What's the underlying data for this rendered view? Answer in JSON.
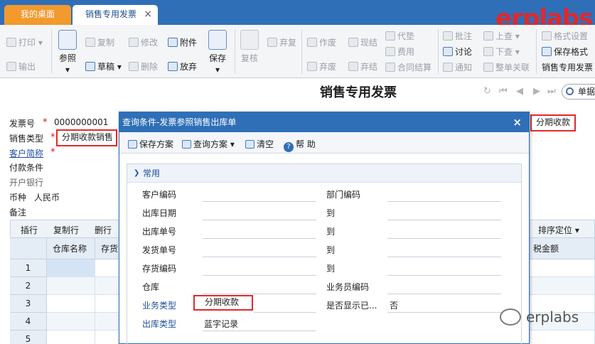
{
  "tabs": {
    "home": "我的桌面",
    "active": "销售专用发票",
    "close": "×"
  },
  "brand": "erplabs",
  "toolbar": {
    "print": "打印",
    "export": "输出",
    "reference": "参照",
    "copy": "复制",
    "draft": "草稿",
    "modify": "修改",
    "delete": "删除",
    "attach": "附件",
    "discard": "放弃",
    "save": "保存",
    "review": "复核",
    "abandon_review": "弃复",
    "void": "作废",
    "abandon_void": "弃废",
    "cash": "现结",
    "abandon_cash": "弃结",
    "agent_pay": "代垫",
    "expense": "费用",
    "contract_settle": "合同结算",
    "annotate": "批注",
    "discuss": "讨论",
    "notify": "通知",
    "prev": "上查",
    "next": "下查",
    "bill_link": "整单关联",
    "format_settings": "格式设置",
    "save_format": "保存格式",
    "template": "销售专用发票"
  },
  "page_title": "销售专用发票",
  "search_placeholder": "单据",
  "header_fields": {
    "invoice_no_label": "发票号",
    "invoice_no_value": "0000000001",
    "sales_type_label": "销售类型",
    "sales_type_value": "分期收款销售",
    "customer_label": "客户简称",
    "payment_label": "付款条件",
    "bank_label": "开户银行",
    "currency_label": "币种",
    "currency_value": "人民币",
    "remark_label": "备注",
    "right_box_value": "分期收款"
  },
  "grid_toolbar": {
    "insert": "插行",
    "copy_row": "复制行",
    "delete_row": "删行",
    "sort": "排序定位"
  },
  "columns": {
    "warehouse": "仓库名称",
    "inventory": "存货",
    "tax_amount": "税金额"
  },
  "rows": [
    "1",
    "2",
    "3",
    "4",
    "5"
  ],
  "dialog": {
    "title": "查询条件-发票参照销售出库单",
    "close": "×",
    "save_scheme": "保存方案",
    "query_scheme": "查询方案",
    "clear": "清空",
    "help": "帮 助",
    "section": "常用",
    "fields": {
      "customer_code": "客户编码",
      "dept_code": "部门编码",
      "out_date": "出库日期",
      "out_no": "出库单号",
      "ship_no": "发货单号",
      "inv_code": "存货编码",
      "warehouse": "仓库",
      "salesman_code": "业务员编码",
      "biz_type": "业务类型",
      "biz_type_value": "分期收款",
      "show_done": "是否显示已...",
      "show_done_value": "否",
      "out_type": "出库类型",
      "out_type_value": "蓝字记录",
      "to": "到"
    }
  },
  "watermark": "erplabs"
}
